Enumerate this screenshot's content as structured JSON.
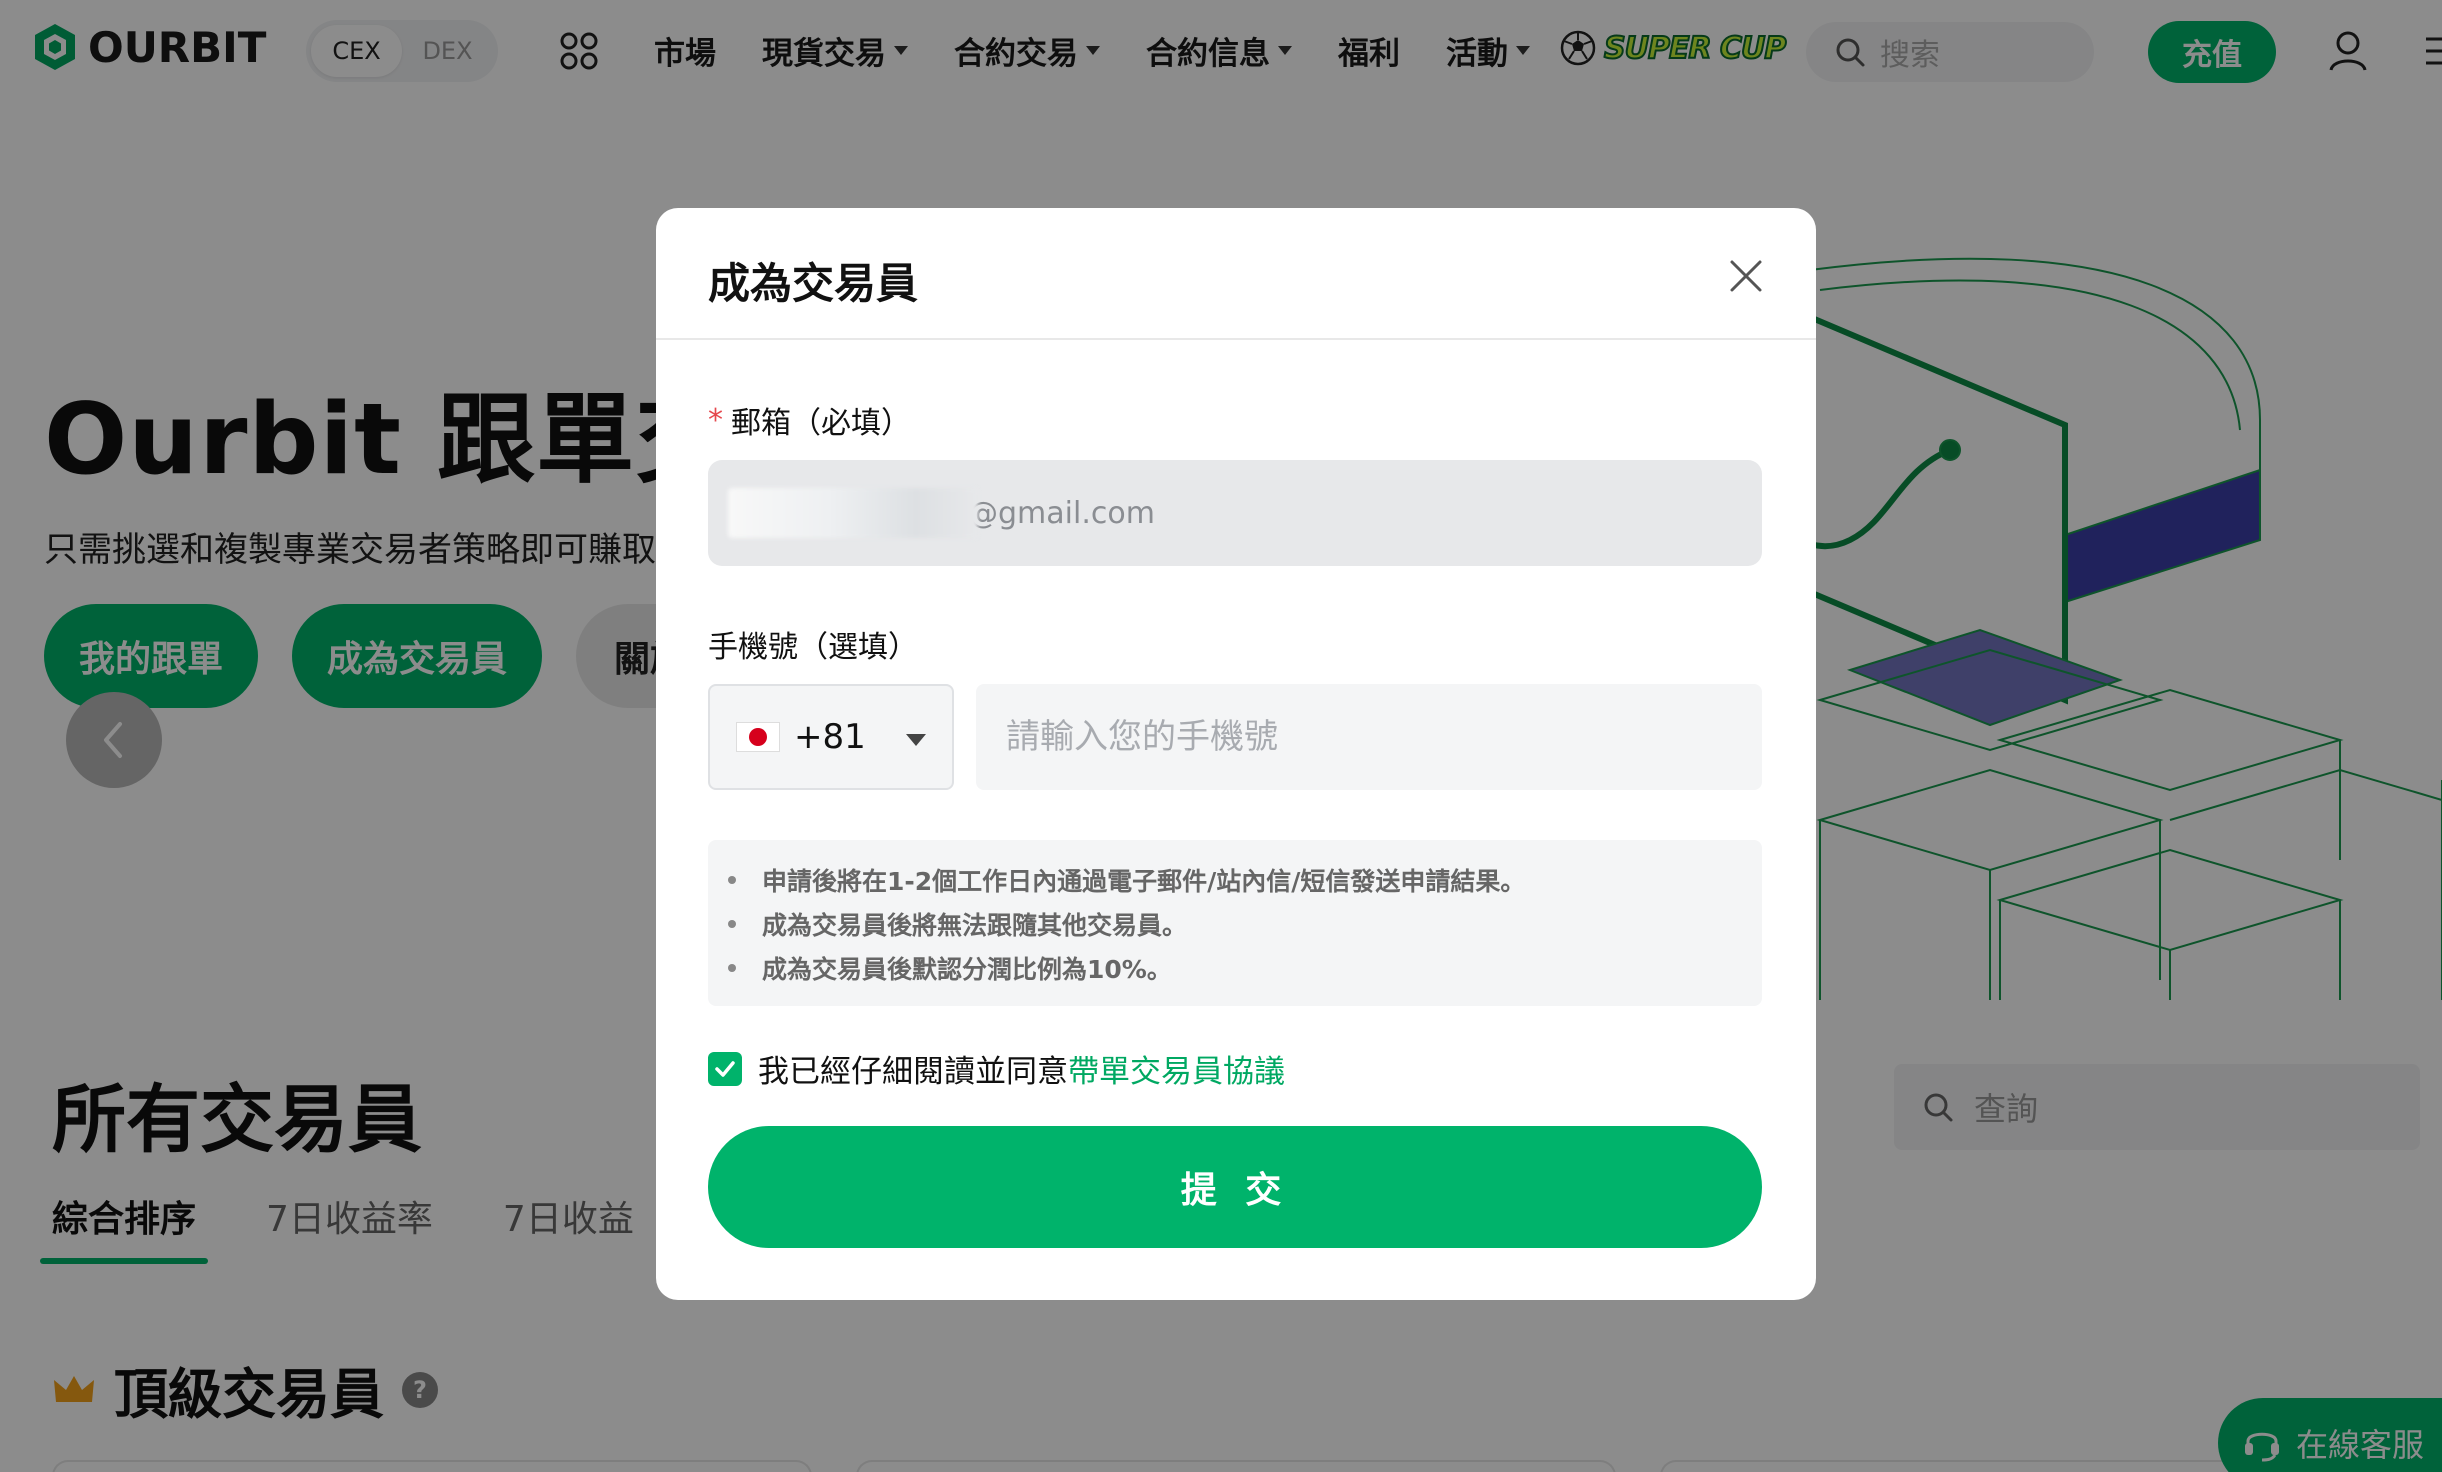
{
  "header": {
    "logo_text": "OURBIT",
    "toggle": [
      "CEX",
      "DEX"
    ],
    "nav": [
      {
        "label": "市場",
        "caret": false
      },
      {
        "label": "現貨交易",
        "caret": true
      },
      {
        "label": "合約交易",
        "caret": true
      },
      {
        "label": "合約信息",
        "caret": true
      },
      {
        "label": "福利",
        "caret": false
      },
      {
        "label": "活動",
        "caret": true
      }
    ],
    "promo_label": "SUPER CUP",
    "search_placeholder": "搜索",
    "deposit_label": "充值"
  },
  "page": {
    "hero_title": "Ourbit 跟單交",
    "hero_subtitle": "只需挑選和複製專業交易者策略即可賺取",
    "buttons": [
      "我的跟單",
      "成為交易員",
      "關於"
    ],
    "section_title": "所有交易員",
    "tabs": [
      "綜合排序",
      "7日收益率",
      "7日收益"
    ],
    "query_placeholder": "查詢",
    "top_traders_title": "頂級交易員",
    "support_label": "在線客服"
  },
  "modal": {
    "title": "成為交易員",
    "email_label": "郵箱（必填）",
    "email_value": "@gmail.com",
    "phone_label": "手機號（選填）",
    "country_code": "+81",
    "phone_placeholder": "請輸入您的手機號",
    "notices": [
      "申請後將在1-2個工作日內通過電子郵件/站內信/短信發送申請結果。",
      "成為交易員後將無法跟隨其他交易員。",
      "成為交易員後默認分潤比例為10%。"
    ],
    "agree_text": "我已經仔細閱讀並同意",
    "agree_link": "帶單交易員協議",
    "agree_checked": true,
    "submit_label": "提 交"
  },
  "colors": {
    "brand": "#00b36b",
    "overlay": "rgba(0,0,0,0.45)",
    "required": "#e5484d"
  }
}
